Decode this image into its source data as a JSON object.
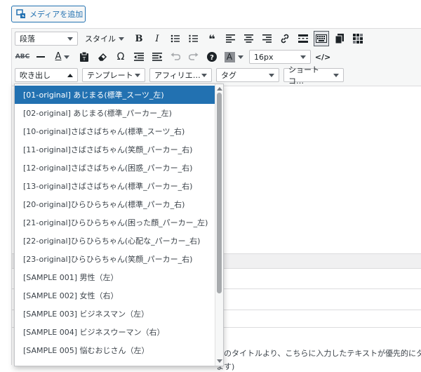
{
  "media_button": {
    "label": "メディアを追加",
    "icon": "media-icon"
  },
  "toolbar": {
    "format_select": "段落",
    "style_select": "スタイル",
    "font_size_select": "16px",
    "fukidashi_select": "吹き出し",
    "template_select": "テンプレート",
    "affiliate_select": "アフィリエ…",
    "tag_select": "タグ",
    "shortcode_select": "ショートコ…",
    "text_color_letter": "A",
    "bg_color_letter": "A",
    "omega": "Ω",
    "accent_color": "#2271b1"
  },
  "dropdown": {
    "items": [
      "[01-original] あじまる(標準_スーツ_左)",
      "[02-original] あじまる(標準_パーカー_左)",
      "[10-original]さばさばちゃん(標準_スーツ_右)",
      "[11-original]さばさばちゃん(笑顔_パーカー_右)",
      "[12-original]さばさばちゃん(困惑_パーカー_右)",
      "[13-original]さばさばちゃん(標準_パーカー_右)",
      "[20-original]ひらひらちゃん(標準_パーカ_右)",
      "[21-original]ひらひらちゃん(困った顔_パーカー_左)",
      "[22-original]ひらひらちゃん(心配な_パーカー_右)",
      "[23-original]ひらひらちゃん(笑顔_パーカー_右)",
      "[SAMPLE 001] 男性（左）",
      "[SAMPLE 002] 女性（右）",
      "[SAMPLE 003] ビジネスマン（左）",
      "[SAMPLE 004] ビジネスウーマン（右）",
      "[SAMPLE 005] 悩むおじさん（左）"
    ],
    "selected_index": 0
  },
  "helper": {
    "line1": "事のタイトルより、こちらに入力したテキストが優先的にタイ",
    "line2": "ます)"
  }
}
